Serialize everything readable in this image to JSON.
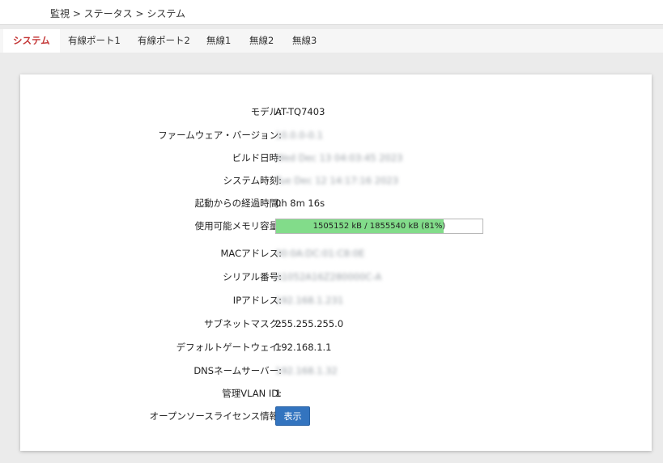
{
  "breadcrumb": "監視 > ステータス > システム",
  "tabs": [
    {
      "label": "システム",
      "active": true
    },
    {
      "label": "有線ポート1",
      "active": false
    },
    {
      "label": "有線ポート2",
      "active": false
    },
    {
      "label": "無線1",
      "active": false
    },
    {
      "label": "無線2",
      "active": false
    },
    {
      "label": "無線3",
      "active": false
    }
  ],
  "rows": {
    "model": {
      "label": "モデル:",
      "value": "AT-TQ7403"
    },
    "firmware": {
      "label": "ファームウェア・バージョン:",
      "value": "10.0.0-0.1"
    },
    "build_date": {
      "label": "ビルド日時:",
      "value": "Wed Dec 13 04:03:45 2023"
    },
    "system_time": {
      "label": "システム時刻:",
      "value": "Tue Dec 12 14:17:16 2023"
    },
    "uptime": {
      "label": "起動からの経過時間:",
      "value": "0h 8m 16s"
    },
    "memory": {
      "label": "使用可能メモリ容量:",
      "value": "1505152 kB / 1855540 kB (81%)",
      "fraction": 0.81
    },
    "mac": {
      "label": "MACアドレス:",
      "value": "00:0A:DC:01:C8:0E"
    },
    "serial": {
      "label": "シリアル番号:",
      "value": "A1052A16Z280000C-A"
    },
    "ip": {
      "label": "IPアドレス:",
      "value": "192.168.1.231"
    },
    "subnet": {
      "label": "サブネットマスク:",
      "value": "255.255.255.0"
    },
    "gateway": {
      "label": "デフォルトゲートウェイ:",
      "value": "192.168.1.1"
    },
    "dns": {
      "label": "DNSネームサーバー:",
      "value": "192.168.1.32"
    },
    "vlan": {
      "label": "管理VLAN ID:",
      "value": "1"
    },
    "oss": {
      "label": "オープンソースライセンス情報:",
      "button": "表示"
    }
  },
  "colors": {
    "accent": "#c43737",
    "progress": "#82dc8a",
    "button": "#3374bf"
  }
}
